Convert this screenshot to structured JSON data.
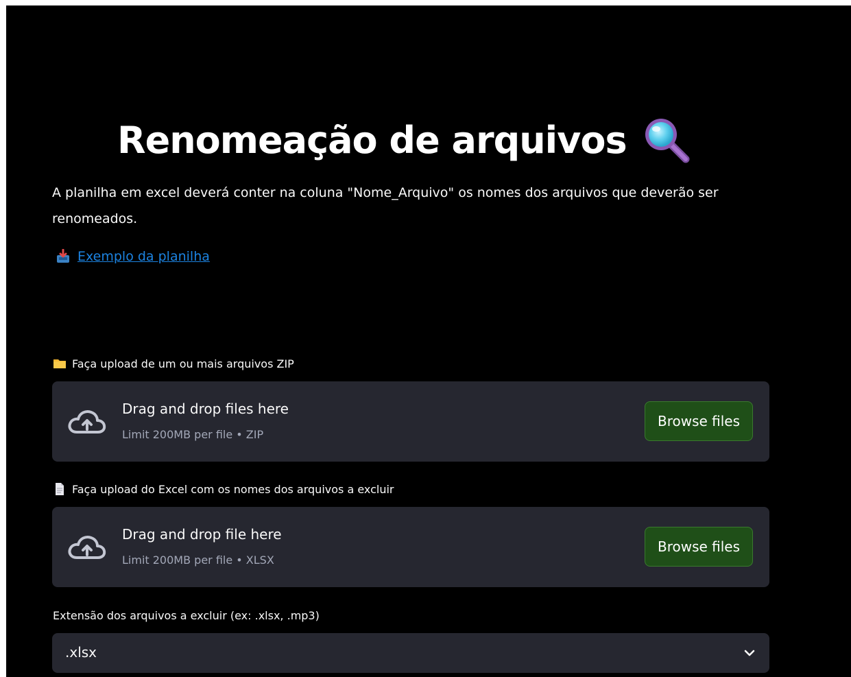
{
  "header": {
    "title": "Renomeação de arquivos",
    "title_icon": "magnifying-glass-icon"
  },
  "description": "A planilha em excel deverá conter na coluna \"Nome_Arquivo\" os nomes dos arquivos que deverão ser renomeados.",
  "example": {
    "icon": "inbox-tray-icon",
    "link_text": "Exemplo da planilha"
  },
  "zip_upload": {
    "icon": "folder-icon",
    "label": "Faça upload de um ou mais arquivos ZIP",
    "dropzone_title": "Drag and drop files here",
    "dropzone_limit": "Limit 200MB per file • ZIP",
    "button_label": "Browse files"
  },
  "excel_upload": {
    "icon": "page-icon",
    "label": "Faça upload do Excel com os nomes dos arquivos a excluir",
    "dropzone_title": "Drag and drop file here",
    "dropzone_limit": "Limit 200MB per file • XLSX",
    "button_label": "Browse files"
  },
  "extension_select": {
    "label": "Extensão dos arquivos a excluir (ex: .xlsx, .mp3)",
    "selected_value": ".xlsx"
  },
  "colors": {
    "background": "#000000",
    "surface": "#262730",
    "link": "#1c83e1",
    "button_bg": "#1f4f18",
    "muted_text": "#a3a8b8"
  }
}
